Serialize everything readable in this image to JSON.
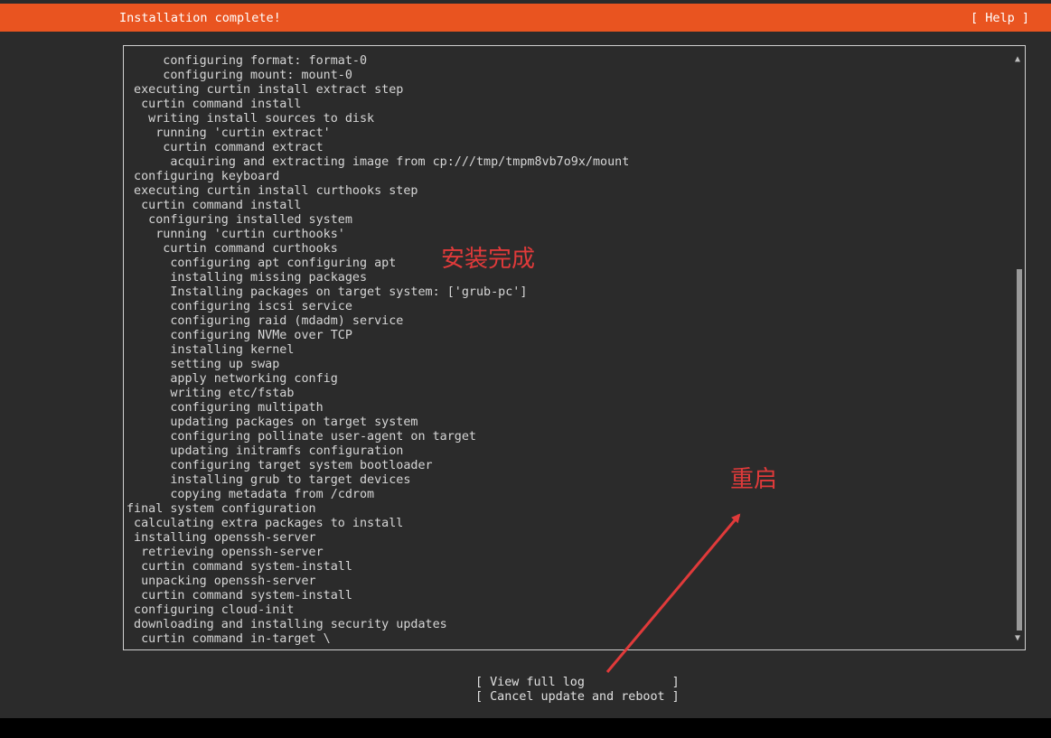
{
  "header": {
    "title": "Installation complete!",
    "help_label": "[ Help ]",
    "accent_color": "#e95420"
  },
  "log": {
    "lines": [
      "     configuring format: format-0",
      "     configuring mount: mount-0",
      " executing curtin install extract step",
      "  curtin command install",
      "   writing install sources to disk",
      "    running 'curtin extract'",
      "     curtin command extract",
      "      acquiring and extracting image from cp:///tmp/tmpm8vb7o9x/mount",
      " configuring keyboard",
      " executing curtin install curthooks step",
      "  curtin command install",
      "   configuring installed system",
      "    running 'curtin curthooks'",
      "     curtin command curthooks",
      "      configuring apt configuring apt",
      "      installing missing packages",
      "      Installing packages on target system: ['grub-pc']",
      "      configuring iscsi service",
      "      configuring raid (mdadm) service",
      "      configuring NVMe over TCP",
      "      installing kernel",
      "      setting up swap",
      "      apply networking config",
      "      writing etc/fstab",
      "      configuring multipath",
      "      updating packages on target system",
      "      configuring pollinate user-agent on target",
      "      updating initramfs configuration",
      "      configuring target system bootloader",
      "      installing grub to target devices",
      "      copying metadata from /cdrom",
      "final system configuration",
      " calculating extra packages to install",
      " installing openssh-server",
      "  retrieving openssh-server",
      "  curtin command system-install",
      "  unpacking openssh-server",
      "  curtin command system-install",
      " configuring cloud-init",
      " downloading and installing security updates",
      "  curtin command in-target \\"
    ]
  },
  "scrollbar": {
    "up_glyph": "▲",
    "down_glyph": "▼"
  },
  "buttons": {
    "view_log": "[ View full log            ]",
    "cancel_reboot": "[ Cancel update and reboot ]"
  },
  "annotations": {
    "install_complete": "安装完成",
    "reboot": "重启",
    "color": "#e03a3a"
  }
}
